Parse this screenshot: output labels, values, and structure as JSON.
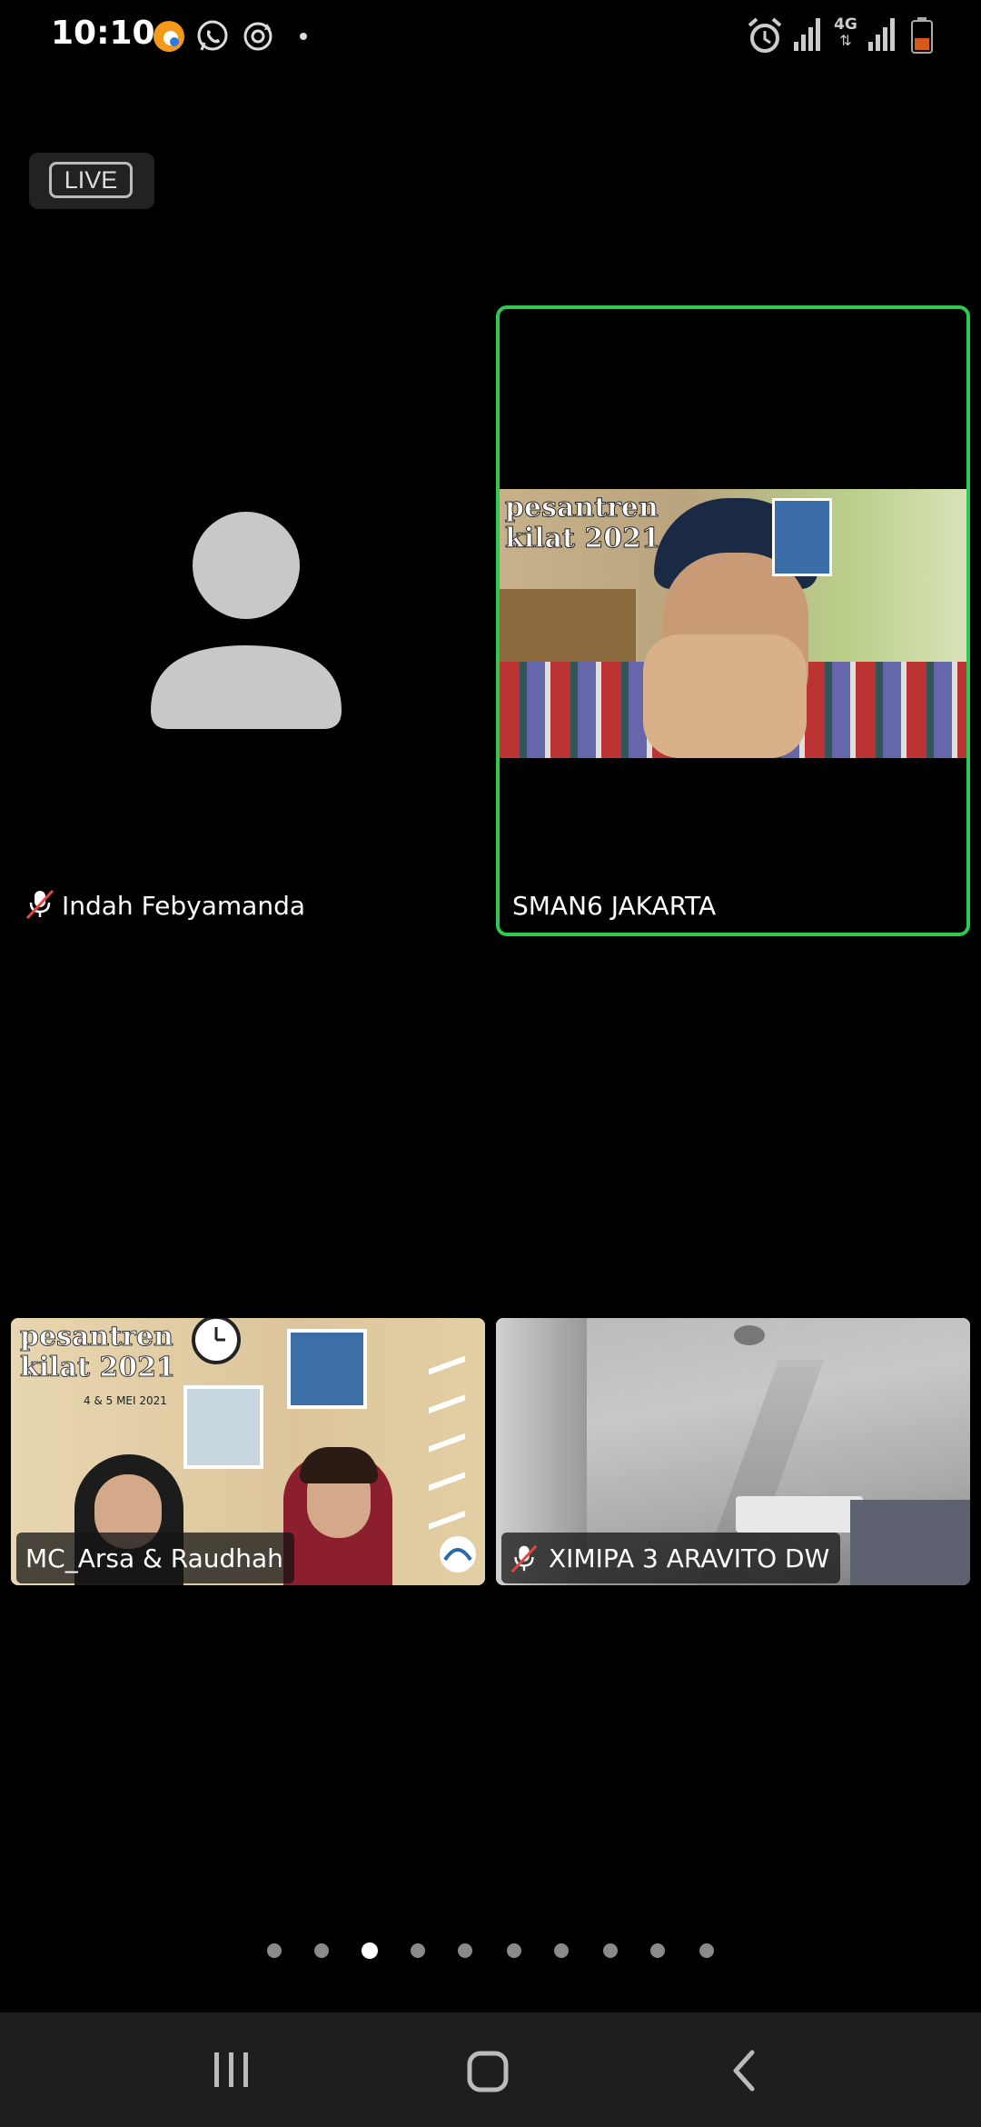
{
  "status_bar": {
    "time": "10:10",
    "left_icons": [
      "app-notification-icon",
      "whatsapp-icon",
      "sync-icon",
      "more-dot-icon"
    ],
    "right_icons": [
      "alarm-icon",
      "signal-icon",
      "4g-icon",
      "signal-icon-2",
      "battery-icon"
    ],
    "network_label": "4G"
  },
  "live_badge": {
    "label": "LIVE"
  },
  "participants": [
    {
      "name": "Indah Febyamanda",
      "muted": true,
      "video": false
    },
    {
      "name": "SMAN6 JAKARTA",
      "muted": false,
      "video": true,
      "active_speaker": true,
      "banner_text": "pesantren\nkilat 2021"
    },
    {
      "name": "MC_Arsa & Raudhah",
      "muted": false,
      "video": true,
      "banner_text": "pesantren\nkilat 2021",
      "banner_date": "4 & 5 MEI 2021"
    },
    {
      "name": "XIMIPA 3 ARAVITO DW",
      "muted": true,
      "video": true
    }
  ],
  "pagination": {
    "total": 10,
    "current": 3
  },
  "nav_bar": {
    "buttons": [
      "recents-button",
      "home-button",
      "back-button"
    ]
  },
  "colors": {
    "active_border": "#2fc94f",
    "background": "#000000",
    "nav_background": "#1e1e1e"
  }
}
